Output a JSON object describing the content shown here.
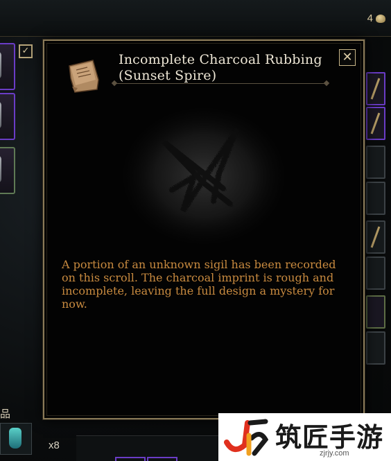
{
  "hud": {
    "currency_amount": "4",
    "currency_icon": "coin-icon"
  },
  "inventory": {
    "section_label": "品",
    "stack_count": "x8",
    "filter_checked": "✓"
  },
  "tooltip": {
    "item_icon": "scroll-icon",
    "title": "Incomplete Charcoal Rubbing (Sunset Spire)",
    "close_label": "✕",
    "art": "charcoal-sigil",
    "description": "A portion of an unknown sigil has been recorded on this scroll. The charcoal imprint is rough and incomplete, leaving the full design a mystery for now.",
    "colors": {
      "description_text": "#c88a3f",
      "title_text": "#eee7d6",
      "frame_border": "#8a7a58",
      "rare_slot": "#6a3cc6"
    }
  },
  "watermark": {
    "brand": "筑匠手游",
    "url": "zjrjy.com"
  }
}
